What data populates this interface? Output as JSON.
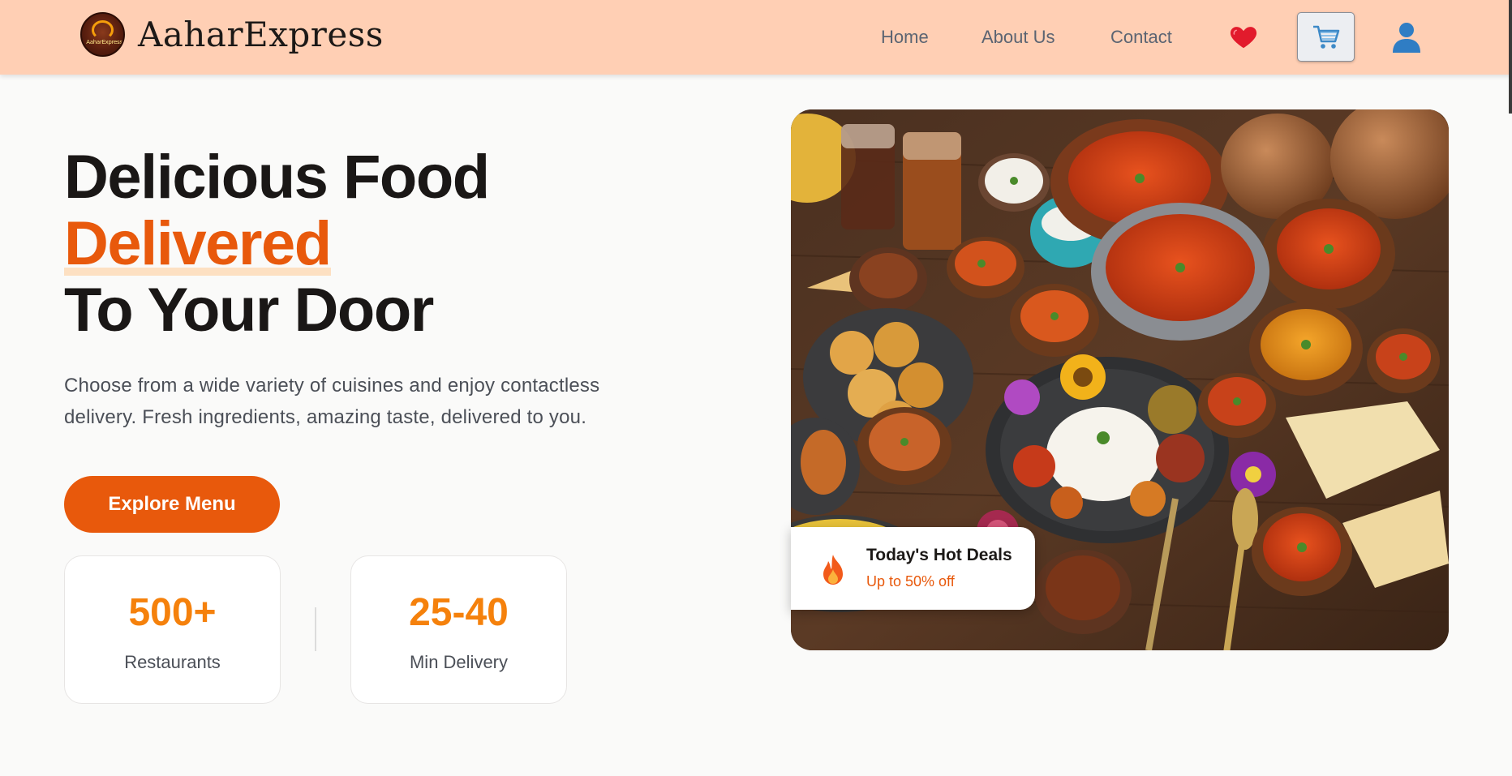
{
  "nav": {
    "brand": "AaharExpress",
    "logo_text": "AaharExpress",
    "links": {
      "home": "Home",
      "about": "About Us",
      "contact": "Contact"
    },
    "icons": {
      "wishlist": "heart-icon",
      "cart": "cart-icon",
      "profile": "user-icon"
    }
  },
  "hero": {
    "headline_line1": "Delicious Food",
    "headline_accent": "Delivered",
    "headline_line3": "To Your Door",
    "description": "Choose from a wide variety of cuisines and enjoy contactless delivery. Fresh ingredients, amazing taste, delivered to you.",
    "cta_label": "Explore Menu",
    "image_alt": "Spread of Indian dishes on a wooden table"
  },
  "stats": [
    {
      "value": "500+",
      "label": "Restaurants"
    },
    {
      "value": "25-40",
      "label": "Min Delivery"
    }
  ],
  "deal": {
    "title": "Today's Hot Deals",
    "subtitle": "Up to 50% off",
    "icon": "fire-icon"
  },
  "colors": {
    "navbar_bg": "#ffcfb4",
    "accent": "#e8590c",
    "stat_number": "#f5810c",
    "page_bg": "#fafaf9"
  }
}
